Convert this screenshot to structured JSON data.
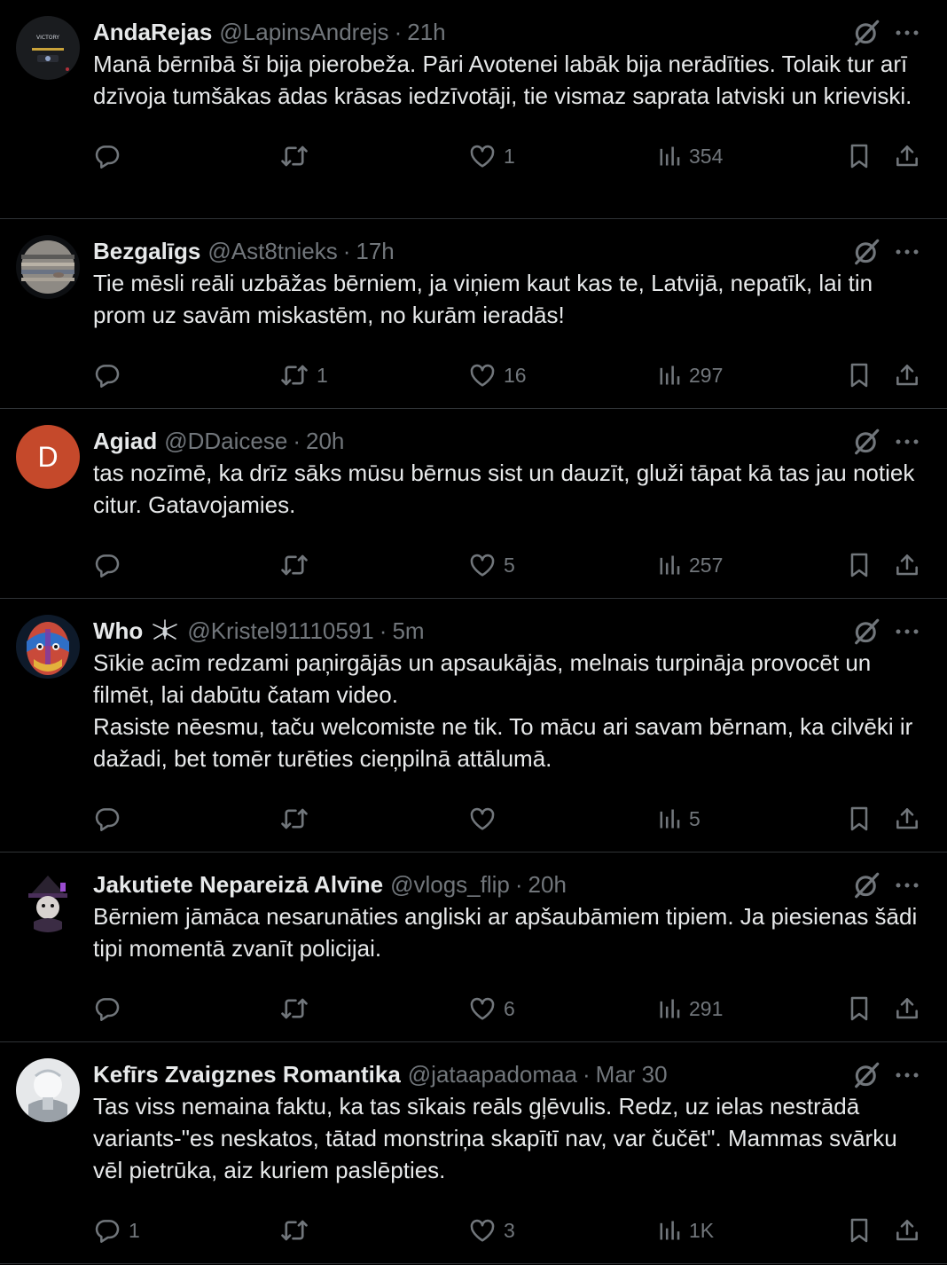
{
  "colors": {
    "background": "#000000",
    "text": "#e7e9ea",
    "muted": "#71767b",
    "divider": "#2f3336"
  },
  "tweets": [
    {
      "name": "AndaRejas",
      "handle": "@LapinsAndrejs",
      "sep": "·",
      "time": "21h",
      "text": "Manā bērnībā šī bija pierobeža. Pāri Avotenei labāk bija nerādīties. Tolaik tur arī dzīvoja tumšākas ādas krāsas iedzīvotāji, tie vismaz saprata latviski un krieviski.",
      "replies": "",
      "retweets": "",
      "likes": "1",
      "views": "354",
      "avatar_text": "VICTORY"
    },
    {
      "name": "Bezgalīgs",
      "handle": "@Ast8tnieks",
      "sep": "·",
      "time": "17h",
      "text": "Tie mēsli reāli uzbāžas bērniem, ja viņiem kaut kas te, Latvijā, nepatīk, lai tin prom uz savām miskastēm, no kurām ieradās!",
      "replies": "",
      "retweets": "1",
      "likes": "16",
      "views": "297"
    },
    {
      "name": "Agiad",
      "handle": "@DDaicese",
      "sep": "·",
      "time": "20h",
      "text": "tas nozīmē, ka drīz sāks mūsu bērnus sist un dauzīt, gluži tāpat kā tas jau notiek citur. Gatavojamies.",
      "replies": "",
      "retweets": "",
      "likes": "5",
      "views": "257",
      "avatar_letter": "D"
    },
    {
      "name": "Who",
      "handle": "@Kristel91110591",
      "sep": "·",
      "time": "5m",
      "text": "Sīkie acīm redzami paņirgājās un apsaukājās, melnais turpināja provocēt un filmēt, lai dabūtu čatam video.\nRasiste nēesmu, taču welcomiste ne tik. To mācu ari savam bērnam, ka cilvēki ir dažadi, bet tomēr turēties cieņpilnā attālumā.",
      "replies": "",
      "retweets": "",
      "likes": "",
      "views": "5"
    },
    {
      "name": "Jakutiete Nepareizā Alvīne",
      "handle": "@vlogs_flip",
      "sep": "·",
      "time": "20h",
      "text": "Bērniem jāmāca nesarunāties angliski ar apšaubāmiem tipiem. Ja piesienas šādi tipi momentā zvanīt policijai.",
      "replies": "",
      "retweets": "",
      "likes": "6",
      "views": "291"
    },
    {
      "name": "Kefīrs Zvaigznes Romantika",
      "handle": "@jataapadomaa",
      "sep": "·",
      "time": "Mar 30",
      "text": "Tas viss nemaina faktu, ka tas sīkais reāls gļēvulis. Redz, uz ielas nestrādā variants-\"es neskatos, tātad monstriņa skapītī nav, var čučēt\". Mammas svārku vēl pietrūka, aiz kuriem paslēpties.",
      "replies": "1",
      "retweets": "",
      "likes": "3",
      "views": "1K"
    }
  ]
}
